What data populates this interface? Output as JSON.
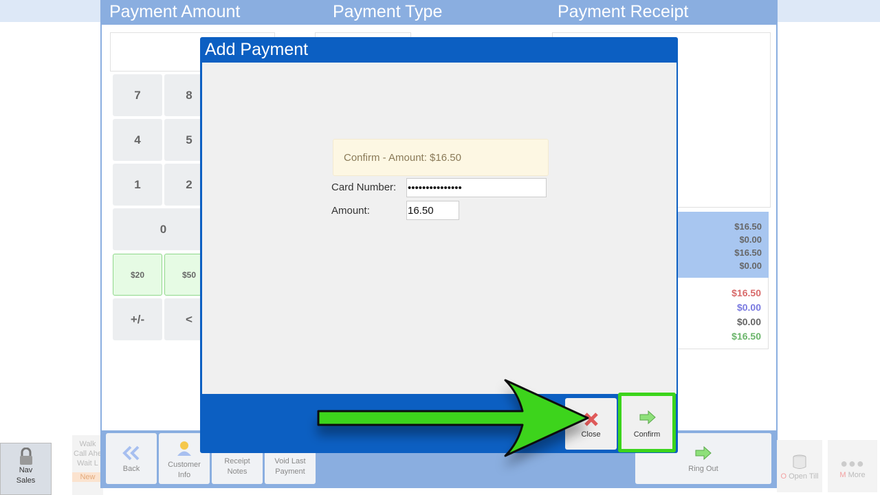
{
  "header": {
    "payment_amount": "Payment Amount",
    "payment_type": "Payment Type",
    "payment_receipt": "Payment Receipt"
  },
  "keypad": {
    "k7": "7",
    "k8": "8",
    "k4": "4",
    "k5": "5",
    "k1": "1",
    "k2": "2",
    "k0": "0",
    "k20": "$20",
    "k50": "$50",
    "plusminus": "+/-",
    "back": "<"
  },
  "totals": {
    "blue": [
      "$16.50",
      "$0.00",
      "$16.50",
      "$0.00"
    ],
    "white": [
      {
        "value": "$16.50",
        "color": "#d86a6a"
      },
      {
        "value": "$0.00",
        "color": "#7a7ae0"
      },
      {
        "value": "$0.00",
        "color": "#666666"
      },
      {
        "value": "$16.50",
        "color": "#6bb56b"
      }
    ]
  },
  "toolbar": {
    "back": "Back",
    "customer_info_1": "Customer",
    "customer_info_2": "Info",
    "receipt_notes_1": "Receipt",
    "receipt_notes_2": "Notes",
    "void_last_1": "Void Last",
    "void_last_2": "Payment",
    "ring_out": "Ring Out",
    "open_till": "Open Till",
    "open_till_prefix": "O",
    "more": "More",
    "more_prefix": "M",
    "nav_1": "Nav",
    "nav_2": "Sales"
  },
  "background_labels": {
    "walk": "Walk",
    "call_ahead": "Call Ahe",
    "wait": "Wait L",
    "new": "New"
  },
  "modal": {
    "title": "Add Payment",
    "confirm_note": "Confirm - Amount: $16.50",
    "card_number_label": "Card Number:",
    "card_number_value": "•••••••••••••••",
    "amount_label": "Amount:",
    "amount_value": "16.50",
    "close_label": "Close",
    "confirm_label": "Confirm"
  },
  "colors": {
    "modal_blue": "#0c5fc2",
    "header_blue": "#8aaee0",
    "highlight_green": "#3cd41c"
  }
}
